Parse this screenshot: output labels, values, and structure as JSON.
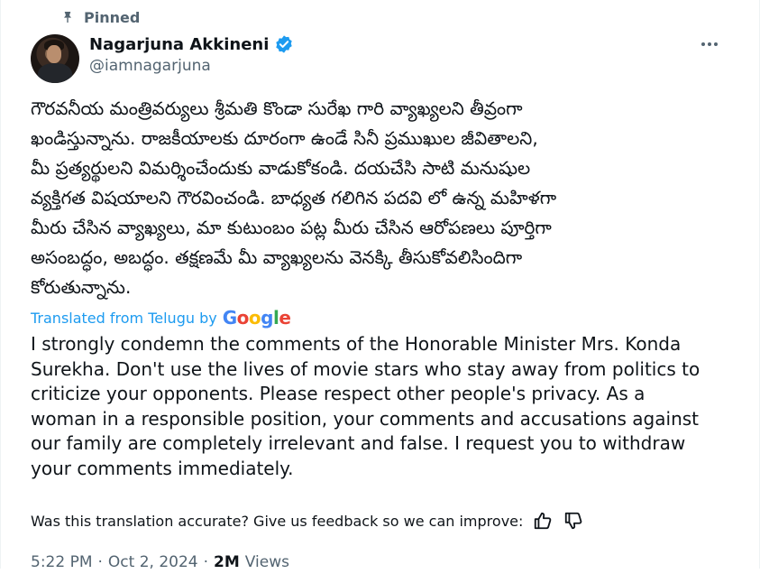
{
  "pinned": {
    "label": "Pinned",
    "icon": "pin-icon"
  },
  "author": {
    "name": "Nagarjuna Akkineni",
    "handle": "@iamnagarjuna",
    "verified_icon": "verified-badge-icon",
    "verified_color": "#1d9bf0"
  },
  "more_icon": "more-options-icon",
  "tweet": {
    "original_text": "గౌరవనీయ మంత్రివర్యులు శ్రీమతి కొండా సురేఖ గారి వ్యాఖ్యలని తీవ్రంగా\nఖండిస్తున్నాను. రాజకీయాలకు దూరంగా ఉండే సినీ ప్రముఖుల జీవితాలని,\nమీ ప్రత్యర్థులని విమర్శించేందుకు వాడుకోకండి. దయచేసి సాటి మనుషుల\nవ్యక్తిగత విషయాలని గౌరవించండి. బాధ్యత గలిగిన పదవి లో ఉన్న మహిళగా\nమీరు చేసిన వ్యాఖ్యలు, మా కుటుంబం పట్ల మీరు చేసిన ఆరోపణలు పూర్తిగా\nఅసంబద్ధం, అబద్ధం. తక్షణమే మీ వ్యాఖ్యలను వెనక్కి తీసుకోవలిసిందిగా\nకోరుతున్నాను.",
    "translated_label": "Translated from Telugu by",
    "translator": "Google",
    "translated_text": "I strongly condemn the comments of the Honorable Minister Mrs. Konda Surekha. Don't use the lives of movie stars who stay away from politics to criticize your opponents. Please respect other people's privacy. As a woman in a responsible position, your comments and accusations against our family are completely irrelevant and false. I request you to withdraw your comments immediately."
  },
  "feedback": {
    "prompt": "Was this translation accurate? Give us feedback so we can improve:",
    "thumbs_up_icon": "thumbs-up-icon",
    "thumbs_down_icon": "thumbs-down-icon"
  },
  "meta": {
    "time": "5:22 PM",
    "separator": "·",
    "date": "Oct 2, 2024",
    "views_count": "2M",
    "views_label": "Views"
  },
  "colors": {
    "link": "#1d9bf0",
    "secondary_text": "#536471",
    "primary_text": "#0f1419"
  }
}
